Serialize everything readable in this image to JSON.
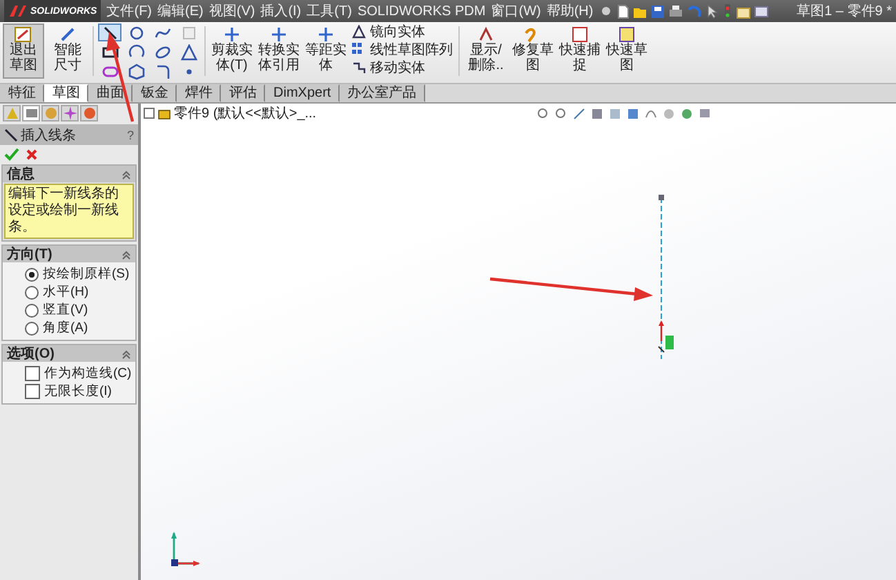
{
  "app": {
    "name": "SOLIDWORKS",
    "title": "草图1 – 零件9 *"
  },
  "menus": [
    "文件(F)",
    "编辑(E)",
    "视图(V)",
    "插入(I)",
    "工具(T)",
    "SOLIDWORKS PDM",
    "窗口(W)",
    "帮助(H)"
  ],
  "ribbon": {
    "exit_sketch": {
      "label": "退出草图",
      "selected": true
    },
    "smart_dimension": "智能尺寸",
    "tools": [
      {
        "kind": "line",
        "selected": true
      },
      {
        "kind": "circle",
        "selected": false
      },
      {
        "kind": "spline",
        "selected": false
      },
      {
        "kind": "plane",
        "selected": false
      },
      {
        "kind": "rectangle",
        "selected": false
      },
      {
        "kind": "arc",
        "selected": false
      },
      {
        "kind": "ellipse",
        "selected": false
      },
      {
        "kind": "triangle",
        "selected": false
      },
      {
        "kind": "slot",
        "selected": false
      },
      {
        "kind": "polygon",
        "selected": false
      },
      {
        "kind": "fillet",
        "selected": false
      },
      {
        "kind": "point",
        "selected": false
      }
    ],
    "big_buttons": [
      "剪裁实体(T)",
      "转换实体引用",
      "等距实体"
    ],
    "list_buttons": [
      {
        "kind": "mirror",
        "label": "镜向实体"
      },
      {
        "kind": "pattern",
        "label": "线性草图阵列"
      },
      {
        "kind": "move",
        "label": "移动实体"
      }
    ],
    "right_buttons": [
      {
        "kind": "display",
        "label": "显示/删除.."
      },
      {
        "kind": "repair",
        "label": "修复草图"
      },
      {
        "kind": "snap",
        "label": "快速捕捉"
      },
      {
        "kind": "rapid",
        "label": "快速草图"
      }
    ]
  },
  "tabs": [
    {
      "label": "特征",
      "selected": false
    },
    {
      "label": "草图",
      "selected": true
    },
    {
      "label": "曲面",
      "selected": false
    },
    {
      "label": "钣金",
      "selected": false
    },
    {
      "label": "焊件",
      "selected": false
    },
    {
      "label": "评估",
      "selected": false
    },
    {
      "label": "DimXpert",
      "selected": false
    },
    {
      "label": "办公室产品",
      "selected": false
    }
  ],
  "panel_tabs": [
    {
      "kind": "feature",
      "selected": false
    },
    {
      "kind": "property",
      "selected": true
    },
    {
      "kind": "config",
      "selected": false
    },
    {
      "kind": "dim",
      "selected": false
    },
    {
      "kind": "display",
      "selected": false
    }
  ],
  "property_manager": {
    "title": "插入线条",
    "help": "?",
    "info": {
      "title": "信息",
      "message": "编辑下一新线条的设定或绘制一新线条。"
    },
    "orientation": {
      "title": "方向(T)",
      "options": [
        {
          "label": "按绘制原样(S)",
          "selected": true
        },
        {
          "label": "水平(H)",
          "selected": false
        },
        {
          "label": "竖直(V)",
          "selected": false
        },
        {
          "label": "角度(A)",
          "selected": false
        }
      ]
    },
    "options": {
      "title": "选项(O)",
      "items": [
        {
          "label": "作为构造线(C)",
          "checked": false
        },
        {
          "label": "无限长度(I)",
          "checked": false
        }
      ]
    }
  },
  "tree": {
    "label": "零件9 (默认<<默认>_..."
  }
}
